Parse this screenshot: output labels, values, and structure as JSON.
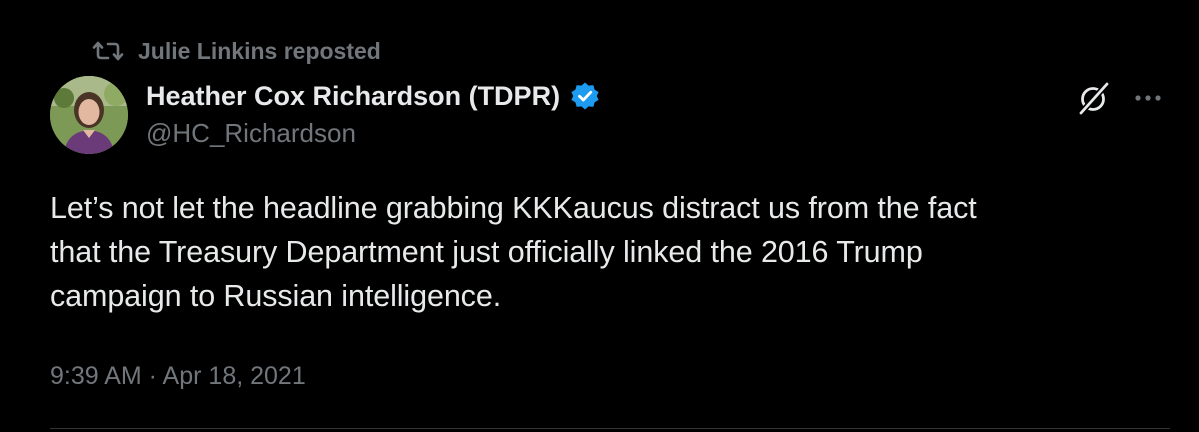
{
  "repost": {
    "icon": "repost-icon",
    "label": "Julie Linkins reposted"
  },
  "author": {
    "display_name": "Heather Cox Richardson (TDPR)",
    "handle": "@HC_Richardson",
    "verified_icon": "verified-badge-icon",
    "verified_color": "#1d9bf0"
  },
  "actions": {
    "grok_icon": "grok-icon",
    "more_icon": "more-options-icon"
  },
  "tweet": {
    "lines": [
      "Let’s not let the headline grabbing KKKaucus distract us from the fact",
      "that the Treasury Department just officially linked the 2016 Trump",
      "campaign to Russian intelligence."
    ],
    "timestamp": "9:39 AM · Apr 18, 2021"
  },
  "colors": {
    "background": "#000000",
    "primary_text": "#e7e9ea",
    "secondary_text": "#71767b",
    "divider": "#2f3336"
  }
}
